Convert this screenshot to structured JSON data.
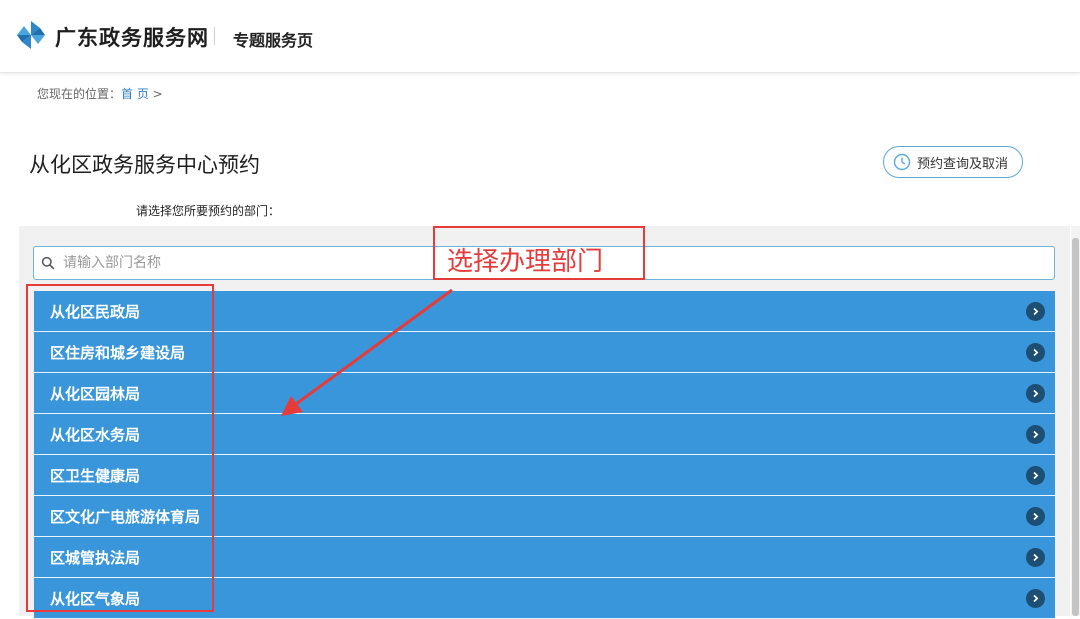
{
  "header": {
    "site_title": "广东政务服务网",
    "subtitle": "专题服务页",
    "logo_icon": "pinwheel-logo-icon"
  },
  "breadcrumb": {
    "prefix": "您现在的位置：",
    "home": "首 页",
    "separator": ">"
  },
  "page": {
    "title": "从化区政务服务中心预约",
    "query_button": "预约查询及取消",
    "prompt": "请选择您所要预约的部门："
  },
  "search": {
    "placeholder": "请输入部门名称",
    "value": ""
  },
  "departments": [
    "从化区民政局",
    "区住房和城乡建设局",
    "从化区园林局",
    "从化区水务局",
    "区卫生健康局",
    "区文化广电旅游体育局",
    "区城管执法局",
    "从化区气象局"
  ],
  "annotation": {
    "label": "选择办理部门"
  },
  "colors": {
    "accent": "#3a96da",
    "annotation": "#e63b3b",
    "arrow_badge": "#1d4e73"
  }
}
